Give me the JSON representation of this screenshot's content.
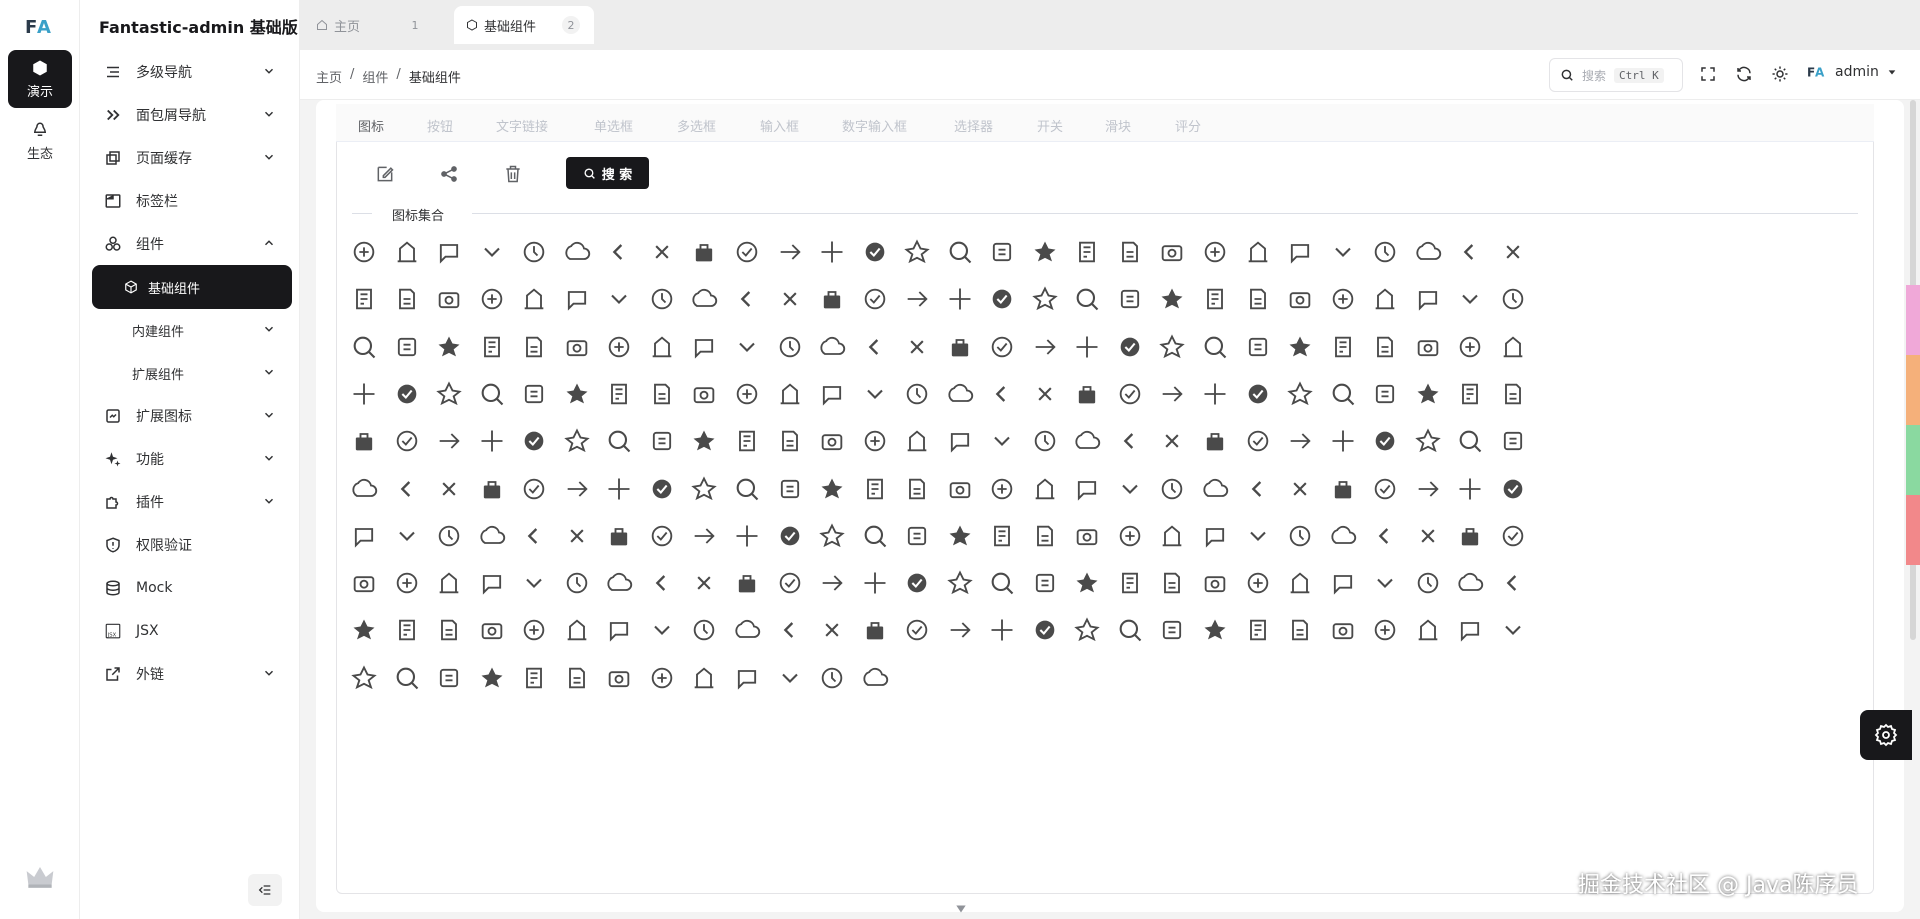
{
  "app": {
    "title": "Fantastic-admin 基础版",
    "logo": "FA"
  },
  "rail": [
    {
      "label": "演示",
      "icon": "cube-icon",
      "active": true
    },
    {
      "label": "生态",
      "icon": "ecosystem-icon",
      "active": false
    }
  ],
  "sidebar": {
    "items": [
      {
        "label": "多级导航",
        "icon": "list-indent-icon",
        "has_children": true,
        "expanded": false
      },
      {
        "label": "面包屑导航",
        "icon": "double-chevron-icon",
        "has_children": true,
        "expanded": false
      },
      {
        "label": "页面缓存",
        "icon": "pages-icon",
        "has_children": true,
        "expanded": false
      },
      {
        "label": "标签栏",
        "icon": "window-icon",
        "has_children": false
      },
      {
        "label": "组件",
        "icon": "components-icon",
        "has_children": true,
        "expanded": true
      },
      {
        "label": "基础组件",
        "icon": "cube-outline-icon",
        "sub": true,
        "active": true
      },
      {
        "label": "内建组件",
        "sub": true,
        "has_children": true,
        "expanded": false
      },
      {
        "label": "扩展组件",
        "sub": true,
        "has_children": true,
        "expanded": false
      },
      {
        "label": "扩展图标",
        "icon": "icon-library-icon",
        "has_children": true,
        "expanded": false
      },
      {
        "label": "功能",
        "icon": "sparkles-icon",
        "has_children": true,
        "expanded": false
      },
      {
        "label": "插件",
        "icon": "puzzle-icon",
        "has_children": true,
        "expanded": false
      },
      {
        "label": "权限验证",
        "icon": "shield-icon",
        "has_children": false
      },
      {
        "label": "Mock",
        "icon": "database-icon",
        "has_children": false
      },
      {
        "label": "JSX",
        "icon": "jsx-icon",
        "has_children": false
      },
      {
        "label": "外链",
        "icon": "external-link-icon",
        "has_children": true,
        "expanded": false
      }
    ]
  },
  "tabs": [
    {
      "label": "主页",
      "num": "1",
      "active": false,
      "icon": "home-icon"
    },
    {
      "label": "基础组件",
      "num": "2",
      "active": true,
      "icon": "cube-outline-icon"
    }
  ],
  "breadcrumb": [
    "主页",
    "组件",
    "基础组件"
  ],
  "search": {
    "placeholder": "搜索",
    "shortcut": "Ctrl K"
  },
  "user": {
    "name": "admin"
  },
  "category_tabs": [
    "图标",
    "按钮",
    "文字链接",
    "单选框",
    "多选框",
    "输入框",
    "数字输入框",
    "选择器",
    "开关",
    "滑块",
    "评分"
  ],
  "active_category": "图标",
  "search_button": "搜 索",
  "section_title": "图标集合",
  "icon_count": 270,
  "watermark": "掘金技术社区 @ Java陈序员",
  "colors": {
    "primary": "#18181b",
    "scroll": [
      "#f0a8d8",
      "#f5b07a",
      "#8ad9a0",
      "#f2888a"
    ]
  }
}
